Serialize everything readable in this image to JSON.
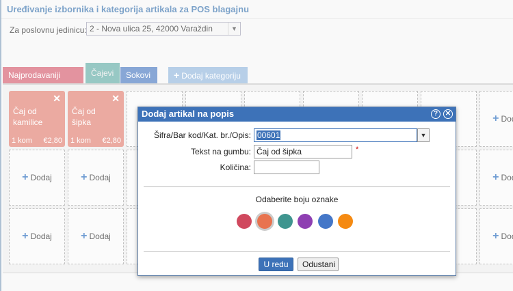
{
  "page": {
    "title": "Uređivanje izbornika i kategorija artikala za POS blagajnu",
    "unit_label": "Za poslovnu jedinicu:",
    "unit_value": "2 - Nova ulica 25, 42000 Varaždin"
  },
  "tabs": [
    {
      "label": "Najprodavaniji artikli",
      "color": "#d86a7b"
    },
    {
      "label": "Čajevi",
      "color": "#6fb3ad"
    },
    {
      "label": "Sokovi",
      "color": "#5b86c7"
    },
    {
      "label": "Dodaj kategoriju",
      "color": "#9bbde0"
    }
  ],
  "items": [
    {
      "name": "Čaj od kamilice",
      "qty": "1 kom",
      "price": "€2,80"
    },
    {
      "name": "Čaj od šipka",
      "qty": "1 kom",
      "price": "€2,80"
    }
  ],
  "add_label": "Dodaj",
  "dialog": {
    "title": "Dodaj artikal na popis",
    "code_label": "Šifra/Bar kod/Kat. br./Opis:",
    "code_value": "00601",
    "text_label": "Tekst na gumbu:",
    "text_value": "Čaj od šipka",
    "required_mark": "*",
    "qty_label": "Količina:",
    "qty_value": "",
    "color_title": "Odaberite boju oznake",
    "colors": [
      "#d0495e",
      "#e8734f",
      "#3f958f",
      "#8e3fb2",
      "#4477c8",
      "#f58a12"
    ],
    "selected_color": "#e8734f",
    "ok_label": "U redu",
    "cancel_label": "Odustani"
  }
}
